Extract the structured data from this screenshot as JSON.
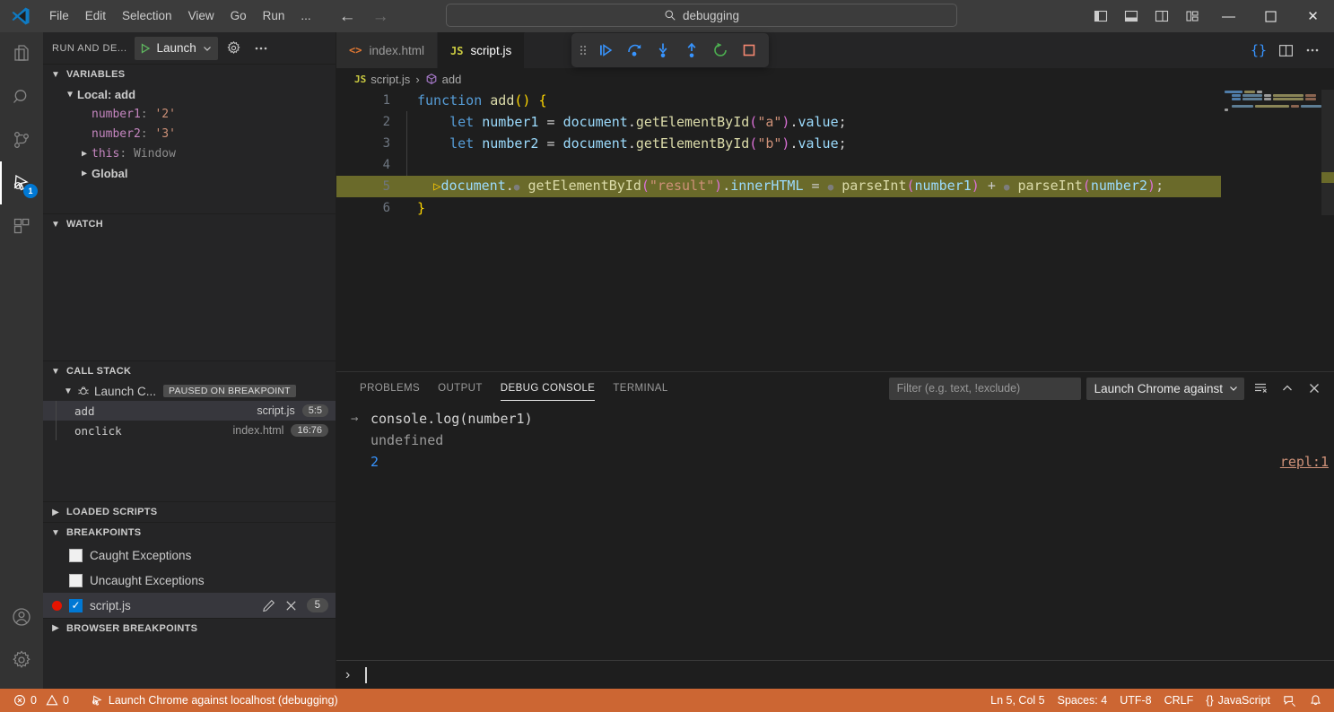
{
  "titlebar": {
    "menus": [
      "File",
      "Edit",
      "Selection",
      "View",
      "Go",
      "Run",
      "..."
    ],
    "search_value": "debugging",
    "search_icon": "search-icon",
    "back_icon": "arrow-left-icon",
    "forward_icon": "arrow-right-icon",
    "layout_toggles": [
      "toggle-primary-sidebar",
      "toggle-panel",
      "toggle-secondary-sidebar",
      "customize-layout"
    ],
    "window_controls": {
      "minimize": "—",
      "maximize": "☐",
      "close": "✕"
    }
  },
  "activitybar": {
    "items": [
      {
        "name": "explorer",
        "icon": "files-icon"
      },
      {
        "name": "search",
        "icon": "search-icon"
      },
      {
        "name": "source-control",
        "icon": "source-control-icon"
      },
      {
        "name": "run-and-debug",
        "icon": "run-and-debug-icon",
        "badge": "1",
        "active": true
      },
      {
        "name": "extensions",
        "icon": "extensions-icon"
      }
    ],
    "bottom": [
      {
        "name": "accounts",
        "icon": "account-icon"
      },
      {
        "name": "settings",
        "icon": "gear-icon"
      }
    ]
  },
  "sidebar": {
    "title": "RUN AND DE...",
    "launch_label": "Launch",
    "launch_icon": "play-icon",
    "settings_icon": "gear-icon",
    "more_icon": "ellipsis-icon",
    "variables": {
      "title": "VARIABLES",
      "scopes": [
        {
          "label": "Local: add",
          "expanded": true,
          "items": [
            {
              "name": "number1",
              "value": "'2'",
              "kind": "string"
            },
            {
              "name": "number2",
              "value": "'3'",
              "kind": "string"
            },
            {
              "name": "this",
              "value": "Window",
              "kind": "object",
              "expandable": true
            }
          ]
        },
        {
          "label": "Global",
          "expanded": false,
          "items": []
        }
      ]
    },
    "watch": {
      "title": "WATCH",
      "items": []
    },
    "call_stack": {
      "title": "CALL STACK",
      "session": {
        "label": "Launch C...",
        "badge": "PAUSED ON BREAKPOINT",
        "icon": "debug-session-icon"
      },
      "frames": [
        {
          "name": "add",
          "file": "script.js",
          "position": "5:5",
          "selected": true
        },
        {
          "name": "onclick",
          "file": "index.html",
          "position": "16:76",
          "selected": false
        }
      ]
    },
    "loaded_scripts": {
      "title": "LOADED SCRIPTS"
    },
    "breakpoints": {
      "title": "BREAKPOINTS",
      "items": [
        {
          "label": "Caught Exceptions",
          "checked": false,
          "dot": false
        },
        {
          "label": "Uncaught Exceptions",
          "checked": false,
          "dot": false
        },
        {
          "label": "script.js",
          "checked": true,
          "dot": true,
          "line": "5",
          "selected": true,
          "actions": [
            "edit-icon",
            "remove-icon"
          ]
        }
      ]
    },
    "browser_breakpoints": {
      "title": "BROWSER BREAKPOINTS"
    }
  },
  "editor": {
    "tabs": [
      {
        "label": "index.html",
        "icon": "html-file-icon",
        "active": false
      },
      {
        "label": "script.js",
        "icon": "js-file-icon",
        "active": true
      }
    ],
    "actions": [
      {
        "name": "run-or-debug-icon",
        "glyph": "{}"
      },
      {
        "name": "split-editor-icon"
      },
      {
        "name": "more-actions-icon",
        "glyph": "…"
      }
    ],
    "debug_toolbar": {
      "grip": "drag-handle-icon",
      "buttons": [
        "continue-icon",
        "step-over-icon",
        "step-into-icon",
        "step-out-icon",
        "restart-icon",
        "stop-icon"
      ]
    },
    "breadcrumb": {
      "file": "script.js",
      "file_icon": "js-file-icon",
      "separator": "›",
      "symbol": "add",
      "symbol_icon": "symbol-method-icon"
    },
    "lines": [
      {
        "num": "1",
        "text": "function add() {"
      },
      {
        "num": "2",
        "text": "    let number1 = document.getElementById(\"a\").value;"
      },
      {
        "num": "3",
        "text": "    let number2 = document.getElementById(\"b\").value;"
      },
      {
        "num": "4",
        "text": ""
      },
      {
        "num": "5",
        "text": "    document.getElementById(\"result\").innerHTML = parseInt(number1) + parseInt(number2);",
        "current": true,
        "breakpoint": true
      },
      {
        "num": "6",
        "text": "}"
      }
    ]
  },
  "panel": {
    "tabs": [
      {
        "label": "PROBLEMS",
        "active": false
      },
      {
        "label": "OUTPUT",
        "active": false
      },
      {
        "label": "DEBUG CONSOLE",
        "active": true
      },
      {
        "label": "TERMINAL",
        "active": false
      }
    ],
    "filter_placeholder": "Filter (e.g. text, !exclude)",
    "filter_value": "",
    "session_label": "Launch Chrome against",
    "actions": [
      "clear-console-icon",
      "collapse-panel-icon",
      "close-panel-icon"
    ],
    "console": [
      {
        "kind": "input",
        "text": "console.log(number1)",
        "arrow": "→"
      },
      {
        "kind": "undefined",
        "text": "undefined"
      },
      {
        "kind": "number",
        "text": "2",
        "link": "repl:1"
      }
    ],
    "repl_prompt": "›"
  },
  "statusbar": {
    "background": "#cc6633",
    "errors": "0",
    "warnings": "0",
    "error_icon": "error-circle-icon",
    "warning_icon": "warning-triangle-icon",
    "debug_icon": "debug-session-icon",
    "debug_text": "Launch Chrome against localhost (debugging)",
    "right": [
      {
        "name": "cursor-position",
        "label": "Ln 5, Col 5"
      },
      {
        "name": "indentation",
        "label": "Spaces: 4"
      },
      {
        "name": "encoding",
        "label": "UTF-8"
      },
      {
        "name": "eol",
        "label": "CRLF"
      },
      {
        "name": "language-mode",
        "label": "JavaScript",
        "glyph": "{}"
      }
    ],
    "feedback_icon": "feedback-icon",
    "bell_icon": "bell-icon"
  }
}
